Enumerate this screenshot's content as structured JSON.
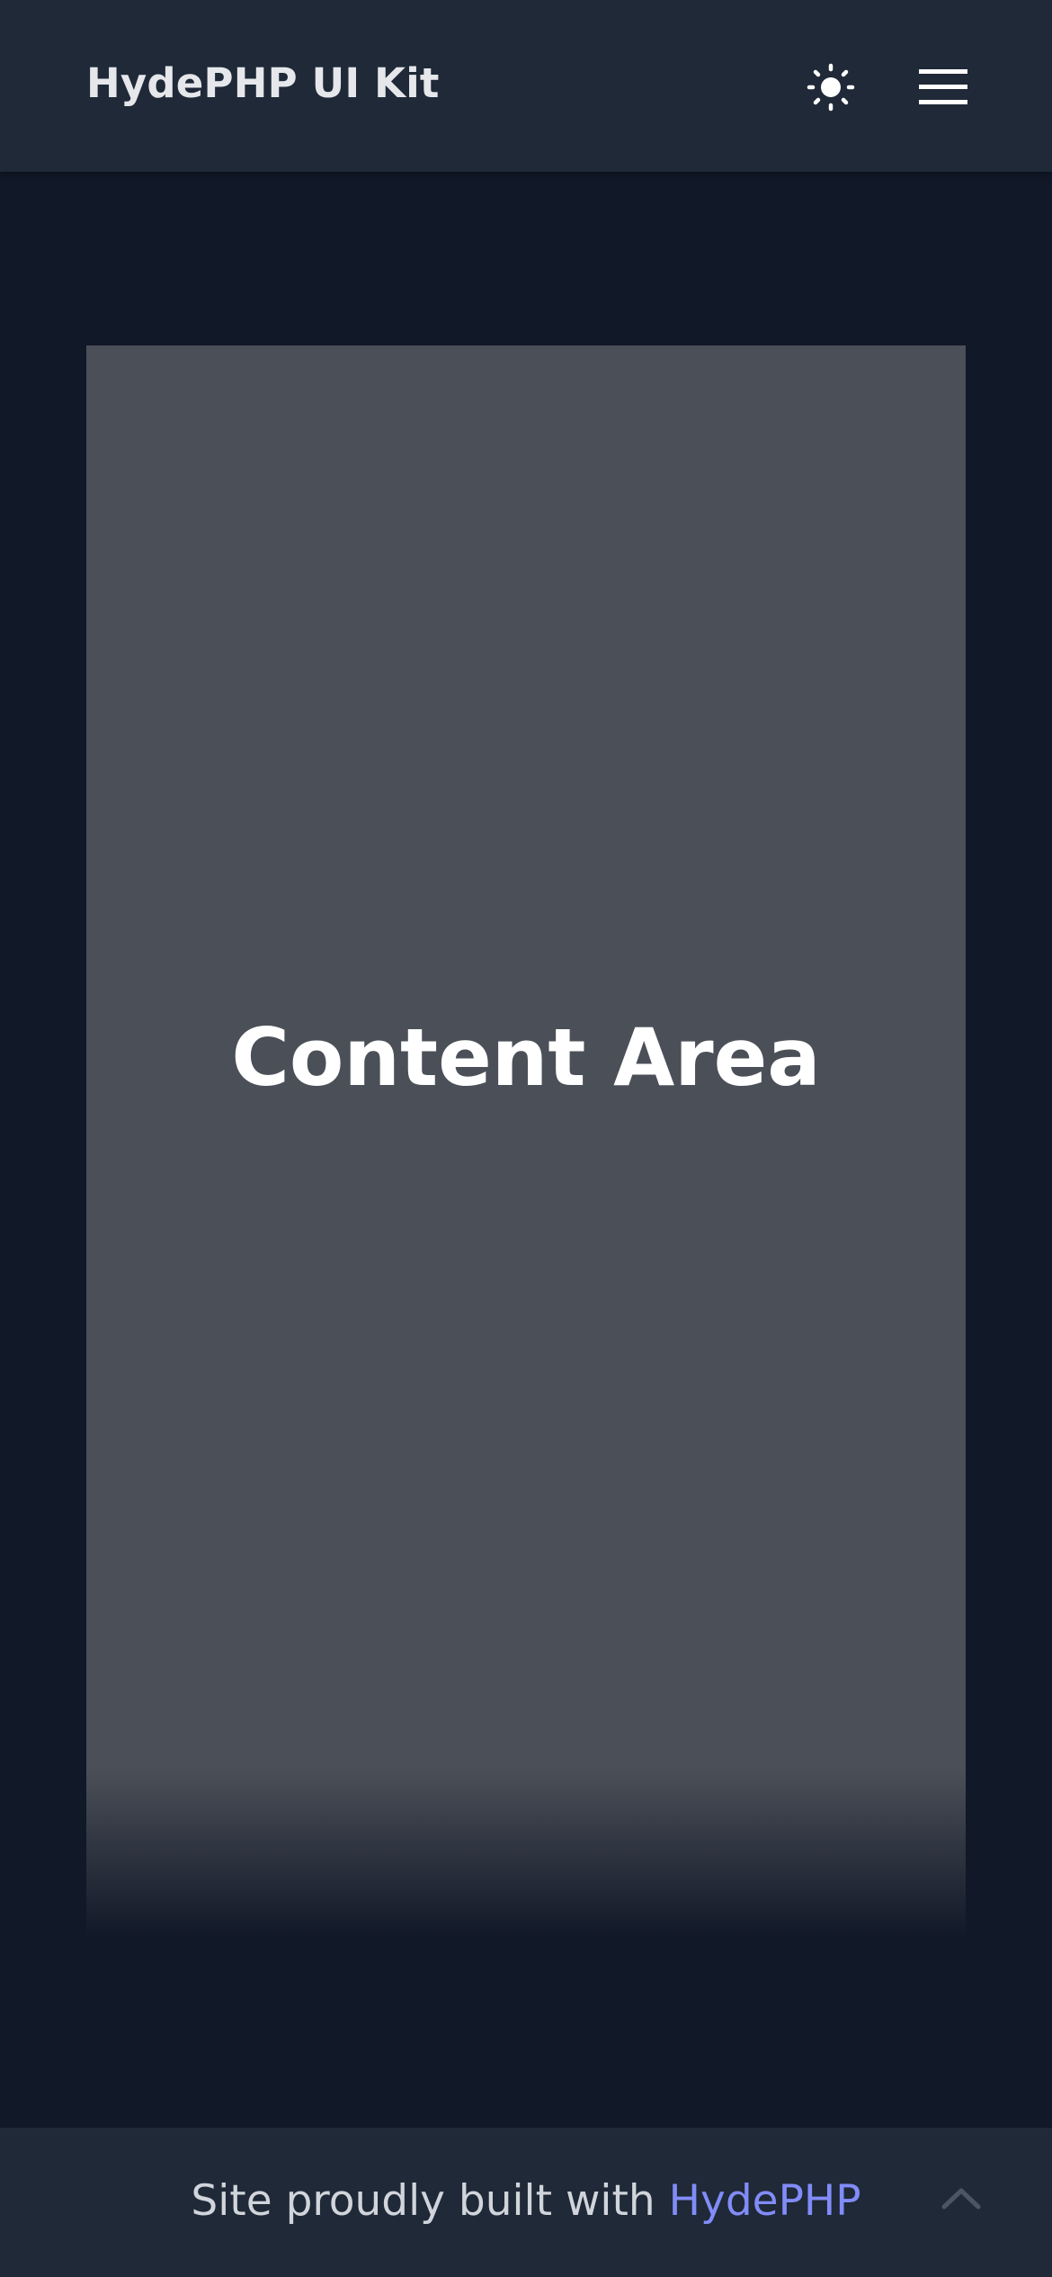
{
  "header": {
    "brand": "HydePHP UI Kit",
    "theme_toggle_icon": "sun-icon",
    "menu_icon": "hamburger-menu-icon"
  },
  "main": {
    "content_title": "Content Area"
  },
  "footer": {
    "text_prefix": "Site proudly built with ",
    "link_label": "HydePHP",
    "back_to_top_icon": "chevron-up-icon"
  },
  "colors": {
    "page_background": "#111827",
    "header_background": "#1f2937",
    "content_background": "#4b5058",
    "accent_link": "#818cf8"
  }
}
